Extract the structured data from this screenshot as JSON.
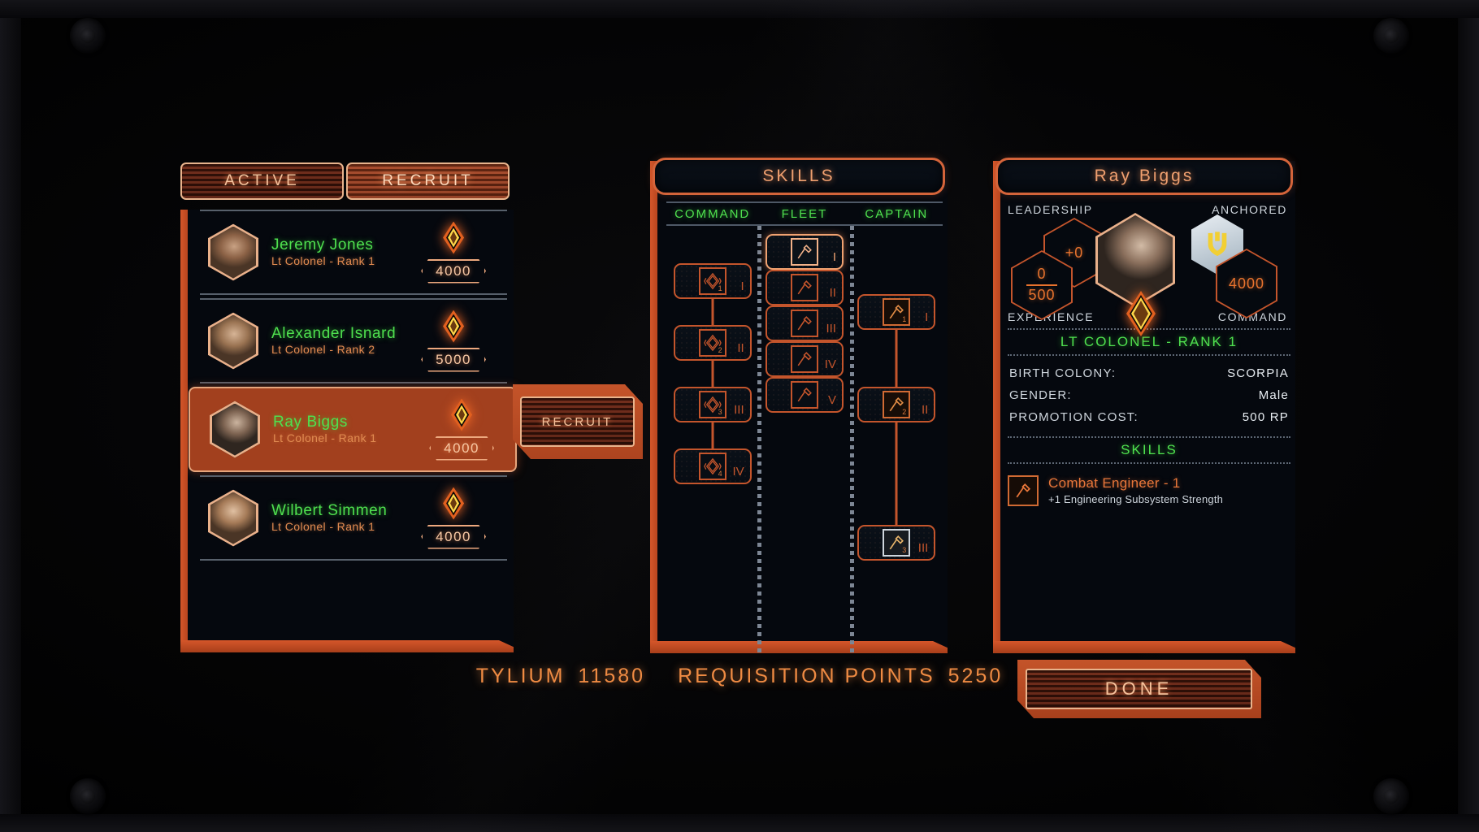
{
  "tabs": [
    {
      "label": "ACTIVE",
      "active": false
    },
    {
      "label": "RECRUIT",
      "active": true
    }
  ],
  "roster": [
    {
      "name": "Jeremy Jones",
      "rank": "Lt Colonel - Rank 1",
      "cost": "4000",
      "selected": false
    },
    {
      "name": "Alexander Isnard",
      "rank": "Lt Colonel - Rank 2",
      "cost": "5000",
      "selected": false
    },
    {
      "name": "Ray Biggs",
      "rank": "Lt Colonel - Rank 1",
      "cost": "4000",
      "selected": true
    },
    {
      "name": "Wilbert Simmen",
      "rank": "Lt Colonel - Rank 1",
      "cost": "4000",
      "selected": false
    }
  ],
  "recruit_button": {
    "label": "RECRUIT"
  },
  "skills_panel": {
    "title": "SKILLS",
    "columns": [
      {
        "label": "COMMAND"
      },
      {
        "label": "FLEET"
      },
      {
        "label": "CAPTAIN"
      }
    ],
    "command_nodes": [
      {
        "rank": "I",
        "level": "1",
        "icon": "command-diamond-icon"
      },
      {
        "rank": "II",
        "level": "2",
        "icon": "command-diamond-icon"
      },
      {
        "rank": "III",
        "level": "3",
        "icon": "command-diamond-icon"
      },
      {
        "rank": "IV",
        "level": "4",
        "icon": "command-diamond-icon"
      }
    ],
    "fleet_nodes": [
      {
        "rank": "I",
        "icon": "hammer-icon",
        "highlighted": true
      },
      {
        "rank": "II",
        "icon": "hammer-icon",
        "highlighted": false
      },
      {
        "rank": "III",
        "icon": "hammer-icon",
        "highlighted": false
      },
      {
        "rank": "IV",
        "icon": "hammer-icon",
        "highlighted": false
      },
      {
        "rank": "V",
        "icon": "hammer-icon",
        "highlighted": false
      }
    ],
    "captain_nodes": [
      {
        "rank": "I",
        "level": "1",
        "icon": "hammer-icon",
        "style": "gold"
      },
      {
        "rank": "II",
        "level": "2",
        "icon": "hammer-icon",
        "style": "gold"
      },
      {
        "rank": "III",
        "level": "3",
        "icon": "hammer-icon",
        "style": "silver"
      }
    ]
  },
  "detail": {
    "name": "Ray Biggs",
    "leadership_label": "LEADERSHIP",
    "leadership_value": "+0",
    "experience_label": "EXPERIENCE",
    "experience_current": "0",
    "experience_max": "500",
    "anchored_label": "ANCHORED",
    "command_label": "COMMAND",
    "command_value": "4000",
    "rank_title": "LT COLONEL - RANK 1",
    "stats": [
      {
        "label": "BIRTH COLONY:",
        "value": "SCORPIA"
      },
      {
        "label": "GENDER:",
        "value": "Male"
      },
      {
        "label": "PROMOTION COST:",
        "value": "500 RP"
      }
    ],
    "skills_header": "SKILLS",
    "skills": [
      {
        "name": "Combat Engineer - 1",
        "desc": "+1 Engineering Subsystem Strength",
        "icon": "hammer-icon"
      }
    ]
  },
  "done_button": {
    "label": "DONE"
  },
  "resources": [
    {
      "label": "TYLIUM",
      "value": "11580"
    },
    {
      "label": "REQUISITION POINTS",
      "value": "5250"
    }
  ],
  "colors": {
    "orange": "#d4562a",
    "orange_light": "#f0a271",
    "green": "#4fe04f",
    "panel_bg": "#05080e",
    "steel": "#cfd6dd"
  }
}
